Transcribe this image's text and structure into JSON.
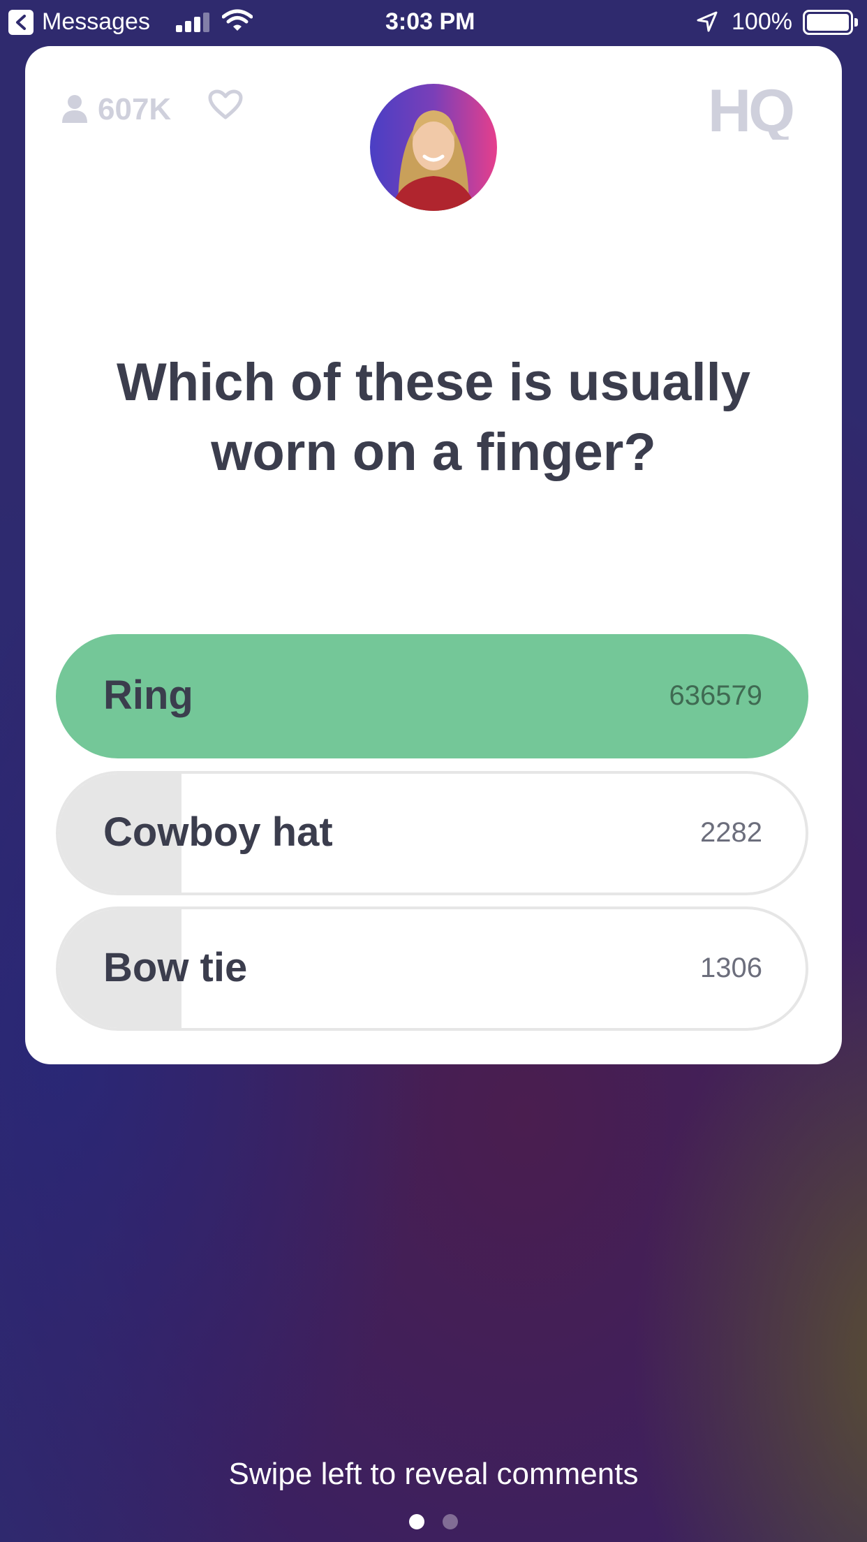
{
  "status_bar": {
    "back_label": "Messages",
    "time": "3:03 PM",
    "battery": "100%"
  },
  "header": {
    "viewer_count": "607K",
    "logo_text": "HQ"
  },
  "question": {
    "text": "Which of these is usually worn on a finger?"
  },
  "answers": [
    {
      "label": "Ring",
      "votes": "636579",
      "correct": true
    },
    {
      "label": "Cowboy hat",
      "votes": "2282",
      "correct": false
    },
    {
      "label": "Bow tie",
      "votes": "1306",
      "correct": false
    }
  ],
  "footer": {
    "swipe_hint": "Swipe left to reveal comments",
    "pages": 2,
    "active_page": 1
  },
  "colors": {
    "correct": "#74c798",
    "text_dark": "#3b3d4d",
    "muted_icon": "#cfd0dc"
  }
}
